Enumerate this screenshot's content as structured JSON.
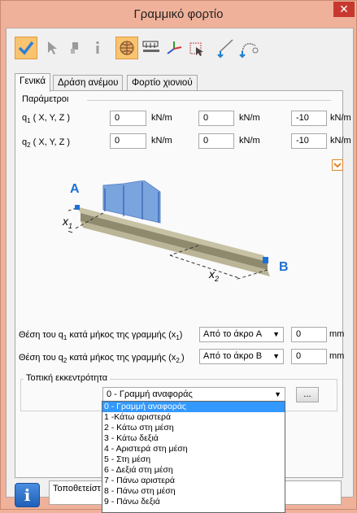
{
  "window": {
    "title": "Γραμμικό φορτίο",
    "close_label": "✕"
  },
  "toolbar": {
    "tools": [
      "check-icon",
      "pointer-icon",
      "paste-icon",
      "info-icon",
      "globe-icon",
      "loads-icon",
      "axes-icon",
      "select-box-icon",
      "line-icon",
      "arc-icon"
    ]
  },
  "tabs": [
    "Γενικά",
    "Δράση ανέμου",
    "Φορτίο χιονιού"
  ],
  "params": {
    "section_label": "Παράμετροι",
    "q1": {
      "label_main": "q",
      "label_sub": "1",
      "label_rest": " ( X, Y, Z )",
      "values": [
        "0",
        "0",
        "-10"
      ]
    },
    "q2": {
      "label_main": "q",
      "label_sub": "2",
      "label_rest": " ( X, Y, Z )",
      "values": [
        "0",
        "0",
        "-10"
      ]
    },
    "unit": "kN/m"
  },
  "diagram": {
    "point_a": "A",
    "point_b": "B",
    "x1_label": "x",
    "x1_sub": "1",
    "x2_label": "x",
    "x2_sub": "2"
  },
  "position": {
    "row1": {
      "label_a": "Θέση του q",
      "sub": "1",
      "label_b": " κατά μήκος της γραμμής (x",
      "sub2": "1",
      "label_c": ")",
      "from": "Από το άκρο A",
      "value": "0",
      "unit": "mm"
    },
    "row2": {
      "label_a": "Θέση του q",
      "sub": "2",
      "label_b": " κατά μήκος της γραμμής (x",
      "sub2": "2,",
      "label_c": ")",
      "from": "Από το άκρο B",
      "value": "0",
      "unit": "mm"
    }
  },
  "eccentricity": {
    "label": "Τοπική εκκεντρότητα",
    "selected": "0 - Γραμμή αναφοράς",
    "more_button": "...",
    "options": [
      "0 - Γραμμή αναφοράς",
      "1 -Κάτω αριστερά",
      "2 - Κάτω στη μέση",
      "3 - Κάτω δεξιά",
      "4 - Αριστερά στη μέση",
      "5 - Στη μέση",
      "6 - Δεξιά στη μέση",
      "7 - Πάνω αριστερά",
      "8 - Πάνω στη μέση",
      "9 - Πάνω δεξιά"
    ]
  },
  "status": {
    "text": "Τοποθετείστ"
  },
  "colors": {
    "accent": "#f9c470",
    "highlight": "#3399ff",
    "point": "#1f6fd6",
    "load": "#5b8fd6"
  }
}
